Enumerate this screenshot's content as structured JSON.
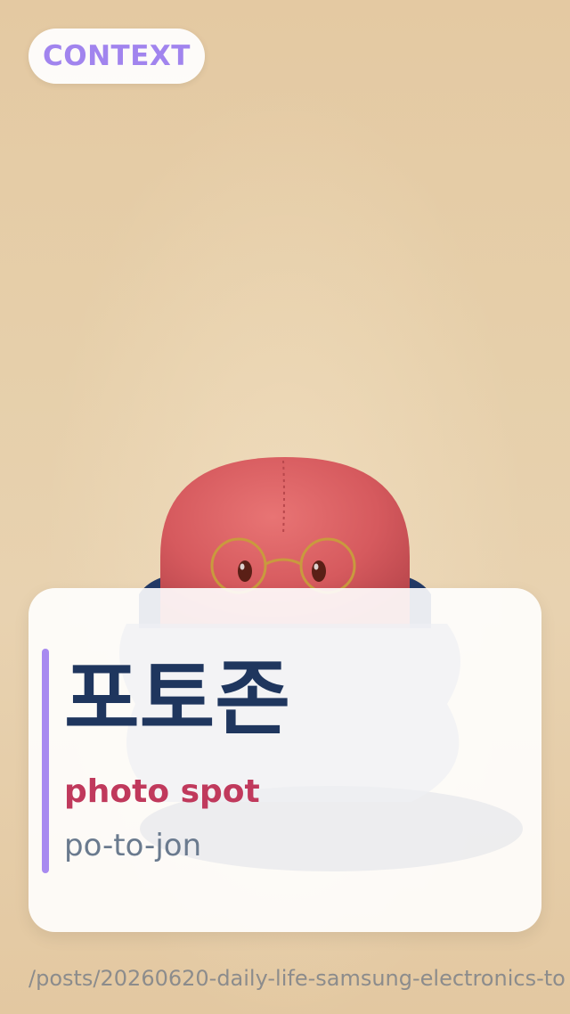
{
  "context_badge": {
    "label": "CONTEXT"
  },
  "mascot": {
    "icon": "red-felt-mascot-with-glasses-icon"
  },
  "vocab_card": {
    "korean": "포토존",
    "english": "photo spot",
    "romanization": "po-to-jon"
  },
  "footer": {
    "path": "/posts/20260620-daily-life-samsung-electronics-to"
  },
  "colors": {
    "accent": "#a88af0",
    "korean_text": "#1f365e",
    "english_text": "#c0395c",
    "romanization_text": "#6a7a8e",
    "badge_text": "#a184ee",
    "path_text": "#8c8c8c"
  }
}
